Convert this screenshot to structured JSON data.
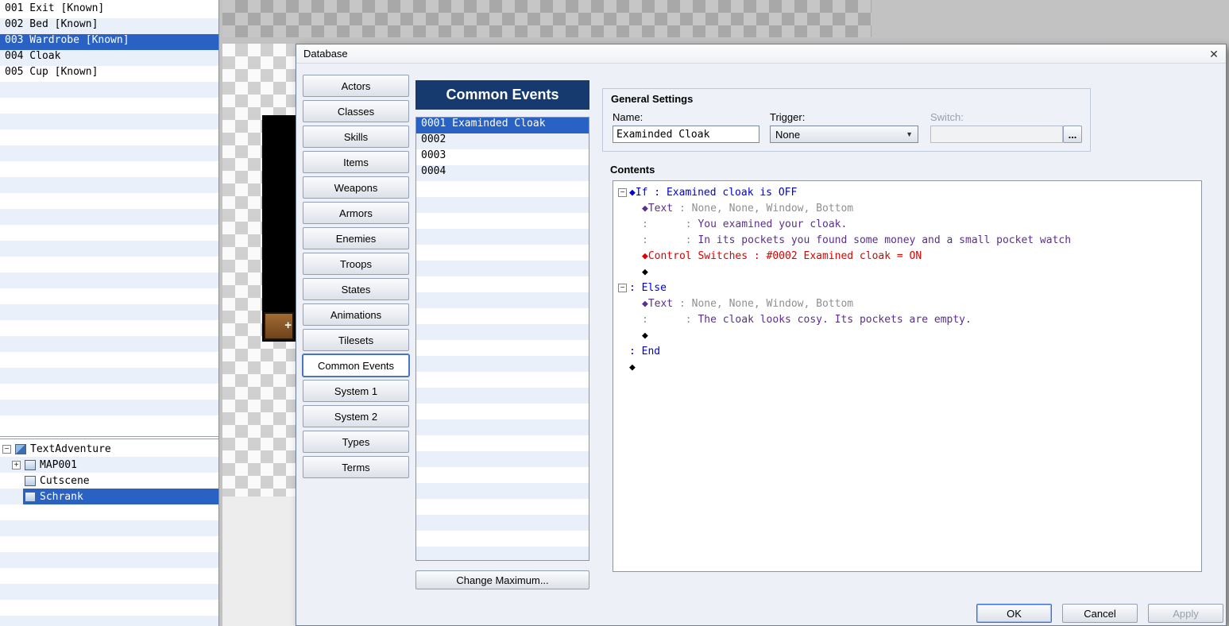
{
  "left_panel": {
    "event_list": {
      "items": [
        {
          "id": "001",
          "label": "Exit [Known]",
          "selected": false
        },
        {
          "id": "002",
          "label": "Bed [Known]",
          "selected": false
        },
        {
          "id": "003",
          "label": "Wardrobe [Known]",
          "selected": true
        },
        {
          "id": "004",
          "label": "Cloak",
          "selected": false
        },
        {
          "id": "005",
          "label": "Cup [Known]",
          "selected": false
        }
      ]
    },
    "tree": {
      "items": [
        {
          "label": "TextAdventure",
          "level": 0,
          "expander": "minus",
          "icon": "project",
          "selected": false
        },
        {
          "label": "MAP001",
          "level": 1,
          "expander": "plus",
          "icon": "map",
          "selected": false
        },
        {
          "label": "Cutscene",
          "level": 1,
          "expander": "",
          "icon": "map",
          "selected": false
        },
        {
          "label": "Schrank",
          "level": 1,
          "expander": "",
          "icon": "map",
          "selected": true
        }
      ]
    }
  },
  "canvas": {
    "plus_marker": "+"
  },
  "dialog": {
    "title": "Database",
    "close_glyph": "✕",
    "tabs": [
      {
        "label": "Actors",
        "selected": false
      },
      {
        "label": "Classes",
        "selected": false
      },
      {
        "label": "Skills",
        "selected": false
      },
      {
        "label": "Items",
        "selected": false
      },
      {
        "label": "Weapons",
        "selected": false
      },
      {
        "label": "Armors",
        "selected": false
      },
      {
        "label": "Enemies",
        "selected": false
      },
      {
        "label": "Troops",
        "selected": false
      },
      {
        "label": "States",
        "selected": false
      },
      {
        "label": "Animations",
        "selected": false
      },
      {
        "label": "Tilesets",
        "selected": false
      },
      {
        "label": "Common Events",
        "selected": true
      },
      {
        "label": "System 1",
        "selected": false
      },
      {
        "label": "System 2",
        "selected": false
      },
      {
        "label": "Types",
        "selected": false
      },
      {
        "label": "Terms",
        "selected": false
      }
    ],
    "list_panel": {
      "header": "Common Events",
      "items": [
        {
          "id": "0001",
          "label": "Examinded Cloak",
          "selected": true
        },
        {
          "id": "0002",
          "label": "",
          "selected": false
        },
        {
          "id": "0003",
          "label": "",
          "selected": false
        },
        {
          "id": "0004",
          "label": "",
          "selected": false
        }
      ],
      "change_maximum_label": "Change Maximum..."
    },
    "general_settings": {
      "title": "General Settings",
      "name_label": "Name:",
      "name_value": "Examinded Cloak",
      "trigger_label": "Trigger:",
      "trigger_value": "None",
      "dropdown_arrow_glyph": "▼",
      "switch_label": "Switch:",
      "switch_value": "",
      "browse_label": "..."
    },
    "contents": {
      "title": "Contents",
      "lines": [
        {
          "exp": "minus",
          "lvl": 0,
          "seg": [
            [
              "◆If : Examined cloak is OFF",
              "flow"
            ]
          ]
        },
        {
          "exp": "",
          "lvl": 1,
          "seg": [
            [
              "◆Text",
              "textcmd"
            ],
            [
              " : None, None, Window, Bottom",
              "param"
            ]
          ]
        },
        {
          "exp": "",
          "lvl": 1,
          "seg": [
            [
              ":      : ",
              "param"
            ],
            [
              "You examined your cloak.",
              "textbody"
            ]
          ]
        },
        {
          "exp": "",
          "lvl": 1,
          "seg": [
            [
              ":      : ",
              "param"
            ],
            [
              "In its pockets you found some money and a small pocket watch",
              "textbody"
            ]
          ]
        },
        {
          "exp": "",
          "lvl": 1,
          "seg": [
            [
              "◆Control Switches : #0002 Examined cloak = ON",
              "switch"
            ]
          ]
        },
        {
          "exp": "",
          "lvl": 1,
          "seg": [
            [
              "◆",
              "plain"
            ]
          ]
        },
        {
          "exp": "minus",
          "lvl": 0,
          "seg": [
            [
              ": Else",
              "flow"
            ]
          ]
        },
        {
          "exp": "",
          "lvl": 1,
          "seg": [
            [
              "◆Text",
              "textcmd"
            ],
            [
              " : None, None, Window, Bottom",
              "param"
            ]
          ]
        },
        {
          "exp": "",
          "lvl": 1,
          "seg": [
            [
              ":      : ",
              "param"
            ],
            [
              "The cloak looks cosy. Its pockets are empty.",
              "textbody"
            ]
          ]
        },
        {
          "exp": "",
          "lvl": 1,
          "seg": [
            [
              "◆",
              "plain"
            ]
          ]
        },
        {
          "exp": "",
          "lvl": 0,
          "seg": [
            [
              ": End",
              "flow"
            ]
          ]
        },
        {
          "exp": "",
          "lvl": 0,
          "seg": [
            [
              "◆",
              "plain"
            ]
          ]
        }
      ]
    },
    "buttons": {
      "ok": "OK",
      "cancel": "Cancel",
      "apply": "Apply"
    }
  },
  "colors": {
    "selection": "#2a62c4",
    "list_stripe": "#e9f0f9",
    "header_bg": "#163a6e",
    "code_flow": "#0000d8",
    "code_text_command": "#5c2d91",
    "code_text_body": "#5c2d91",
    "code_param": "#8f8f8f",
    "code_switch": "#dc0000"
  }
}
